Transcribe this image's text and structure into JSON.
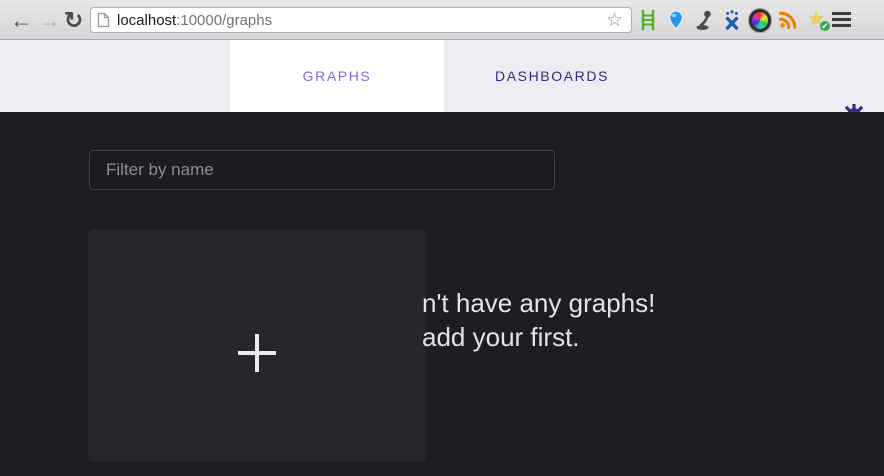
{
  "browser": {
    "back_glyph": "←",
    "forward_glyph": "→",
    "refresh_glyph": "↻",
    "url_host": "localhost",
    "url_rest": ":10000/graphs",
    "bookmark_glyph": "☆",
    "extensions": [
      "ladder",
      "balloon-pin",
      "lamp",
      "people-x",
      "aperture",
      "rss",
      "star-check"
    ],
    "check_glyph": "✔"
  },
  "header": {
    "tabs": [
      {
        "label": "GRAPHS",
        "active": true
      },
      {
        "label": "DASHBOARDS",
        "active": false
      }
    ],
    "colors": {
      "bg": "#ececf2",
      "active_tab_bg": "#ffffff",
      "active_tab_text": "#7b6be4",
      "inactive_tab_text": "#312b85",
      "gear": "#322c8a"
    }
  },
  "content": {
    "filter_placeholder": "Filter by name",
    "empty_state_lines": [
      "n't have any graphs!",
      "add your first."
    ],
    "colors": {
      "page_bg": "#1d1d23",
      "card_bg": "#26262d",
      "text": "#e4e4e7",
      "input_border": "#41414b",
      "placeholder": "#8d8d94"
    }
  }
}
